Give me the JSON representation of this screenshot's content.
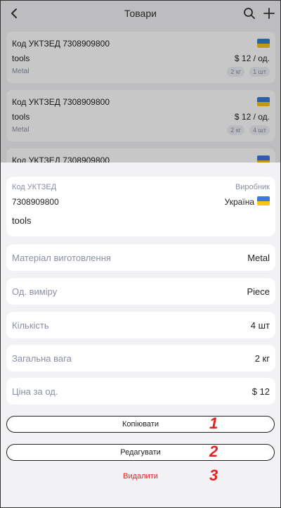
{
  "header": {
    "title": "Товари"
  },
  "product_list": [
    {
      "code": "Код УКТЗЕД 7308909800",
      "name": "tools",
      "material": "Metal",
      "price": "$ 12 / од.",
      "weight": "2 кг",
      "qty": "1 шт",
      "flag": "ukraine-flag-icon"
    },
    {
      "code": "Код УКТЗЕД 7308909800",
      "name": "tools",
      "material": "Metal",
      "price": "$ 12 / од.",
      "weight": "2 кг",
      "qty": "4 шт",
      "flag": "ukraine-flag-icon"
    },
    {
      "code": "Код УКТЗЕД 7308909800"
    }
  ],
  "sheet": {
    "code_label": "Код УКТЗЕД",
    "code_value": "7308909800",
    "manufacturer_label": "Виробник",
    "manufacturer_value": "Україна",
    "name": "tools",
    "rows": [
      {
        "key": "Матеріал виготовлення",
        "value": "Metal"
      },
      {
        "key": "Од. виміру",
        "value": "Piece"
      },
      {
        "key": "Кількість",
        "value": "4 шт"
      },
      {
        "key": "Загальна вага",
        "value": "2 кг"
      },
      {
        "key": "Ціна за од.",
        "value": "$ 12"
      }
    ],
    "copy_label": "Копіювати",
    "edit_label": "Редагувати",
    "delete_label": "Видалити"
  },
  "markers": [
    "1",
    "2",
    "3"
  ],
  "colors": {
    "flag_blue": "#3a7bd5",
    "flag_yellow": "#f5c518",
    "delete_red": "#e02424",
    "marker_red": "#e02424"
  }
}
